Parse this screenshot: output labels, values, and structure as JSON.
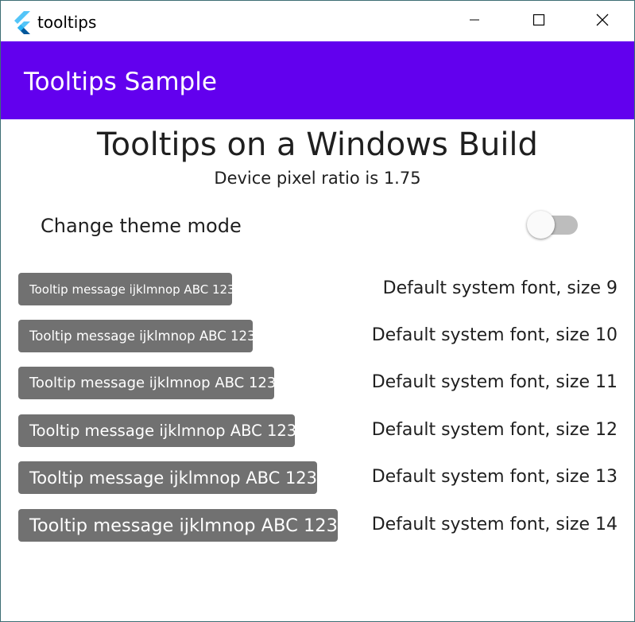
{
  "window": {
    "title": "tooltips",
    "icon": "flutter-logo-icon",
    "controls": [
      "minimize-icon",
      "maximize-icon",
      "close-icon"
    ]
  },
  "appbar": {
    "title": "Tooltips Sample",
    "color": "#6200ee"
  },
  "main": {
    "headline": "Tooltips on a Windows Build",
    "subhead": "Device pixel ratio is 1.75",
    "theme_toggle": {
      "label": "Change theme mode",
      "on": false
    },
    "rows": [
      {
        "tooltip": "Tooltip message ijklmnop ABC 123",
        "label": "Default system font, size 9"
      },
      {
        "tooltip": "Tooltip message ijklmnop ABC 123",
        "label": "Default system font, size 10"
      },
      {
        "tooltip": "Tooltip message ijklmnop ABC 123",
        "label": "Default system font, size 11"
      },
      {
        "tooltip": "Tooltip message ijklmnop ABC 123",
        "label": "Default system font, size 12"
      },
      {
        "tooltip": "Tooltip message ijklmnop ABC 123",
        "label": "Default system font, size 13"
      },
      {
        "tooltip": "Tooltip message ijklmnop ABC 123",
        "label": "Default system font, size 14"
      }
    ],
    "tooltip_color": "#717171"
  }
}
